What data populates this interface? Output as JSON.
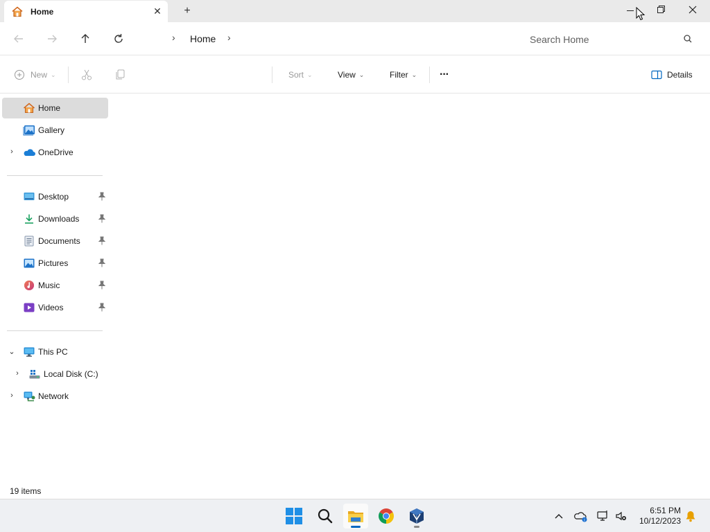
{
  "tab": {
    "title": "Home",
    "icon": "home-icon",
    "close_icon": "close-icon",
    "new_tab_icon": "plus-icon"
  },
  "window_controls": {
    "minimize": "minimize-icon",
    "restore": "restore-icon",
    "close": "close-icon"
  },
  "address": {
    "breadcrumb": [
      "Home"
    ],
    "search_placeholder": "Search Home"
  },
  "commands": {
    "new_label": "New",
    "sort_label": "Sort",
    "view_label": "View",
    "filter_label": "Filter",
    "more_label": "···",
    "details_label": "Details"
  },
  "nav": {
    "home": "Home",
    "gallery": "Gallery",
    "onedrive": "OneDrive",
    "desktop": "Desktop",
    "downloads": "Downloads",
    "documents": "Documents",
    "pictures": "Pictures",
    "music": "Music",
    "videos": "Videos",
    "this_pc": "This PC",
    "local_disk": "Local Disk (C:)",
    "network": "Network"
  },
  "status": {
    "item_count": "19 items"
  },
  "clock": {
    "time": "6:51 PM",
    "date": "10/12/2023"
  },
  "colors": {
    "accent": "#0067c0",
    "folder_yellow": "#f4c542",
    "selected_bg": "#dcdcdc"
  }
}
